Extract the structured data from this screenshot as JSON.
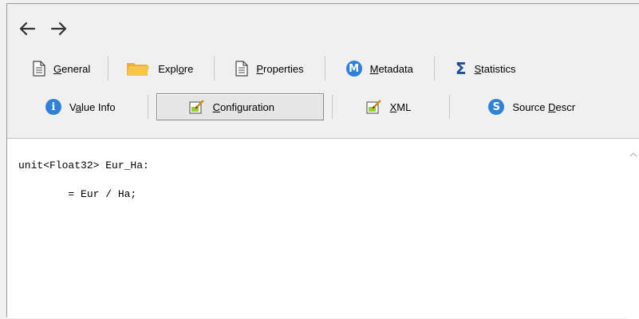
{
  "nav": {
    "back_icon": "arrow-left-icon",
    "forward_icon": "arrow-right-icon"
  },
  "tabs_row1": [
    {
      "label_pre": "",
      "label_ul": "G",
      "label_post": "eneral",
      "icon": "document-icon"
    },
    {
      "label_pre": "Expl",
      "label_ul": "o",
      "label_post": "re",
      "icon": "folder-icon"
    },
    {
      "label_pre": "",
      "label_ul": "P",
      "label_post": "roperties",
      "icon": "document-icon"
    },
    {
      "label_pre": "",
      "label_ul": "M",
      "label_post": "etadata",
      "icon": "metadata-icon",
      "icon_text": "M"
    },
    {
      "label_pre": "",
      "label_ul": "S",
      "label_post": "tatistics",
      "icon": "sigma-icon",
      "icon_text": "Σ"
    }
  ],
  "tabs_row2": [
    {
      "label_pre": "V",
      "label_ul": "a",
      "label_post": "lue Info",
      "icon": "info-icon",
      "icon_text": "i"
    },
    {
      "label_pre": "",
      "label_ul": "C",
      "label_post": "onfiguration",
      "icon": "edit-document-icon",
      "active": true
    },
    {
      "label_pre": "",
      "label_ul": "X",
      "label_post": "ML",
      "icon": "edit-document-icon"
    },
    {
      "label_pre": "Source ",
      "label_ul": "D",
      "label_post": "escr",
      "icon": "source-icon",
      "icon_text": "S"
    }
  ],
  "colors": {
    "circle_blue": "#2f80d8",
    "folder_yellow": "#f6c646"
  },
  "editor": {
    "line1": "unit<Float32> Eur_Ha:",
    "line2": "",
    "line3": "        = Eur / Ha;"
  }
}
